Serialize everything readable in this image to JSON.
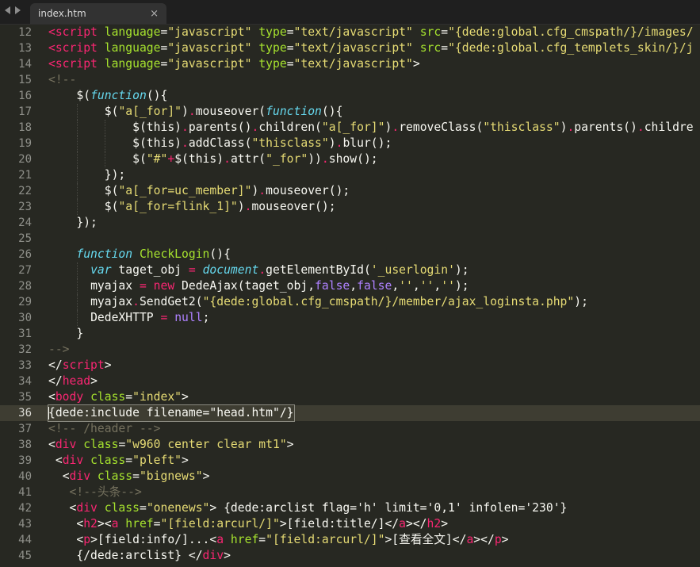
{
  "tab": {
    "title": "index.htm",
    "close_glyph": "×"
  },
  "editor": {
    "current_line": 36,
    "theme_colors": {
      "background": "#272822",
      "tag": "#f92672",
      "attribute": "#a6e22e",
      "string": "#e6db74",
      "comment": "#75715e",
      "keyword": "#66d9ef"
    },
    "lines": [
      {
        "n": 12,
        "indent": 0,
        "tokens": [
          [
            "t",
            "<script "
          ],
          [
            "a",
            "language"
          ],
          [
            "w",
            "="
          ],
          [
            "s",
            "\"javascript\" "
          ],
          [
            "a",
            "type"
          ],
          [
            "w",
            "="
          ],
          [
            "s",
            "\"text/javascript\" "
          ],
          [
            "a",
            "src"
          ],
          [
            "w",
            "="
          ],
          [
            "s",
            "\"{dede:global.cfg_cmspath/}/images/"
          ]
        ]
      },
      {
        "n": 13,
        "indent": 0,
        "tokens": [
          [
            "t",
            "<script "
          ],
          [
            "a",
            "language"
          ],
          [
            "w",
            "="
          ],
          [
            "s",
            "\"javascript\" "
          ],
          [
            "a",
            "type"
          ],
          [
            "w",
            "="
          ],
          [
            "s",
            "\"text/javascript\" "
          ],
          [
            "a",
            "src"
          ],
          [
            "w",
            "="
          ],
          [
            "s",
            "\"{dede:global.cfg_templets_skin/}/j"
          ]
        ]
      },
      {
        "n": 14,
        "indent": 0,
        "tokens": [
          [
            "t",
            "<script "
          ],
          [
            "a",
            "language"
          ],
          [
            "w",
            "="
          ],
          [
            "s",
            "\"javascript\" "
          ],
          [
            "a",
            "type"
          ],
          [
            "w",
            "="
          ],
          [
            "s",
            "\"text/javascript\""
          ],
          [
            "w",
            ">"
          ]
        ]
      },
      {
        "n": 15,
        "indent": 0,
        "tokens": [
          [
            "c",
            "<!--"
          ]
        ]
      },
      {
        "n": 16,
        "indent": 4,
        "tokens": [
          [
            "w",
            "$("
          ],
          [
            "k",
            "function"
          ],
          [
            "w",
            "(){"
          ]
        ]
      },
      {
        "n": 17,
        "indent": 8,
        "tokens": [
          [
            "w",
            "$("
          ],
          [
            "s",
            "\"a[_for]\""
          ],
          [
            "w",
            ")"
          ],
          [
            "o",
            "."
          ],
          [
            "w",
            "mouseover("
          ],
          [
            "k",
            "function"
          ],
          [
            "w",
            "(){"
          ]
        ]
      },
      {
        "n": 18,
        "indent": 12,
        "tokens": [
          [
            "w",
            "$(this)"
          ],
          [
            "o",
            "."
          ],
          [
            "w",
            "parents()"
          ],
          [
            "o",
            "."
          ],
          [
            "w",
            "children("
          ],
          [
            "s",
            "\"a[_for]\""
          ],
          [
            "w",
            ")"
          ],
          [
            "o",
            "."
          ],
          [
            "w",
            "removeClass("
          ],
          [
            "s",
            "\"thisclass\""
          ],
          [
            "w",
            ")"
          ],
          [
            "o",
            "."
          ],
          [
            "w",
            "parents()"
          ],
          [
            "o",
            "."
          ],
          [
            "w",
            "childre"
          ]
        ]
      },
      {
        "n": 19,
        "indent": 12,
        "tokens": [
          [
            "w",
            "$(this)"
          ],
          [
            "o",
            "."
          ],
          [
            "w",
            "addClass("
          ],
          [
            "s",
            "\"thisclass\""
          ],
          [
            "w",
            ")"
          ],
          [
            "o",
            "."
          ],
          [
            "w",
            "blur();"
          ]
        ]
      },
      {
        "n": 20,
        "indent": 12,
        "tokens": [
          [
            "w",
            "$("
          ],
          [
            "s",
            "\"#\""
          ],
          [
            "o",
            "+"
          ],
          [
            "w",
            "$(this)"
          ],
          [
            "o",
            "."
          ],
          [
            "w",
            "attr("
          ],
          [
            "s",
            "\"_for\""
          ],
          [
            "w",
            "))"
          ],
          [
            "o",
            "."
          ],
          [
            "w",
            "show();"
          ]
        ]
      },
      {
        "n": 21,
        "indent": 8,
        "tokens": [
          [
            "w",
            "});"
          ]
        ]
      },
      {
        "n": 22,
        "indent": 8,
        "tokens": [
          [
            "w",
            "$("
          ],
          [
            "s",
            "\"a[_for=uc_member]\""
          ],
          [
            "w",
            ")"
          ],
          [
            "o",
            "."
          ],
          [
            "w",
            "mouseover();"
          ]
        ]
      },
      {
        "n": 23,
        "indent": 8,
        "tokens": [
          [
            "w",
            "$("
          ],
          [
            "s",
            "\"a[_for=flink_1]\""
          ],
          [
            "w",
            ")"
          ],
          [
            "o",
            "."
          ],
          [
            "w",
            "mouseover();"
          ]
        ]
      },
      {
        "n": 24,
        "indent": 4,
        "tokens": [
          [
            "w",
            "});"
          ]
        ]
      },
      {
        "n": 25,
        "indent": 0,
        "tokens": []
      },
      {
        "n": 26,
        "indent": 4,
        "tokens": [
          [
            "k",
            "function"
          ],
          [
            "w",
            " "
          ],
          [
            "f",
            "CheckLogin"
          ],
          [
            "w",
            "(){"
          ]
        ]
      },
      {
        "n": 27,
        "indent": 6,
        "tokens": [
          [
            "k",
            "var"
          ],
          [
            "w",
            " taget_obj "
          ],
          [
            "o",
            "="
          ],
          [
            "w",
            " "
          ],
          [
            "k",
            "document"
          ],
          [
            "o",
            "."
          ],
          [
            "w",
            "getElementById("
          ],
          [
            "s",
            "'_userlogin'"
          ],
          [
            "w",
            ");"
          ]
        ]
      },
      {
        "n": 28,
        "indent": 6,
        "tokens": [
          [
            "w",
            "myajax "
          ],
          [
            "o",
            "="
          ],
          [
            "w",
            " "
          ],
          [
            "o",
            "new"
          ],
          [
            "w",
            " DedeAjax(taget_obj,"
          ],
          [
            "n",
            "false"
          ],
          [
            "w",
            ","
          ],
          [
            "n",
            "false"
          ],
          [
            "w",
            ","
          ],
          [
            "s",
            "''"
          ],
          [
            "w",
            ","
          ],
          [
            "s",
            "''"
          ],
          [
            "w",
            ","
          ],
          [
            "s",
            "''"
          ],
          [
            "w",
            ");"
          ]
        ]
      },
      {
        "n": 29,
        "indent": 6,
        "tokens": [
          [
            "w",
            "myajax"
          ],
          [
            "o",
            "."
          ],
          [
            "w",
            "SendGet2("
          ],
          [
            "s",
            "\"{dede:global.cfg_cmspath/}/member/ajax_loginsta.php\""
          ],
          [
            "w",
            ");"
          ]
        ]
      },
      {
        "n": 30,
        "indent": 6,
        "tokens": [
          [
            "w",
            "DedeXHTTP "
          ],
          [
            "o",
            "="
          ],
          [
            "w",
            " "
          ],
          [
            "n",
            "null"
          ],
          [
            "w",
            ";"
          ]
        ]
      },
      {
        "n": 31,
        "indent": 4,
        "tokens": [
          [
            "w",
            "}"
          ]
        ]
      },
      {
        "n": 32,
        "indent": 0,
        "tokens": [
          [
            "c",
            "-->"
          ]
        ]
      },
      {
        "n": 33,
        "indent": 0,
        "tokens": [
          [
            "w",
            "</"
          ],
          [
            "t",
            "script"
          ],
          [
            "w",
            ">"
          ]
        ]
      },
      {
        "n": 34,
        "indent": 0,
        "tokens": [
          [
            "w",
            "</"
          ],
          [
            "t",
            "head"
          ],
          [
            "w",
            ">"
          ]
        ]
      },
      {
        "n": 35,
        "indent": 0,
        "tokens": [
          [
            "w",
            "<"
          ],
          [
            "t",
            "body "
          ],
          [
            "a",
            "class"
          ],
          [
            "w",
            "="
          ],
          [
            "s",
            "\"index\""
          ],
          [
            "w",
            ">"
          ]
        ]
      },
      {
        "n": 36,
        "indent": 0,
        "tokens": [
          [
            "w",
            "{dede:include "
          ],
          [
            "w",
            "filename"
          ],
          [
            "w",
            "="
          ],
          [
            "w",
            "\"head.htm\""
          ],
          [
            "w",
            "/}"
          ]
        ]
      },
      {
        "n": 37,
        "indent": 0,
        "tokens": [
          [
            "c",
            "<!-- /header -->"
          ]
        ]
      },
      {
        "n": 38,
        "indent": 0,
        "tokens": [
          [
            "w",
            "<"
          ],
          [
            "t",
            "div "
          ],
          [
            "a",
            "class"
          ],
          [
            "w",
            "="
          ],
          [
            "s",
            "\"w960 center clear mt1\""
          ],
          [
            "w",
            ">"
          ]
        ]
      },
      {
        "n": 39,
        "indent": 1,
        "tokens": [
          [
            "w",
            "<"
          ],
          [
            "t",
            "div "
          ],
          [
            "a",
            "class"
          ],
          [
            "w",
            "="
          ],
          [
            "s",
            "\"pleft\""
          ],
          [
            "w",
            ">"
          ]
        ]
      },
      {
        "n": 40,
        "indent": 2,
        "tokens": [
          [
            "w",
            "<"
          ],
          [
            "t",
            "div "
          ],
          [
            "a",
            "class"
          ],
          [
            "w",
            "="
          ],
          [
            "s",
            "\"bignews\""
          ],
          [
            "w",
            ">"
          ]
        ]
      },
      {
        "n": 41,
        "indent": 3,
        "tokens": [
          [
            "c",
            "<!--头条-->"
          ]
        ]
      },
      {
        "n": 42,
        "indent": 3,
        "tokens": [
          [
            "w",
            "<"
          ],
          [
            "t",
            "div "
          ],
          [
            "a",
            "class"
          ],
          [
            "w",
            "="
          ],
          [
            "s",
            "\"onenews\""
          ],
          [
            "w",
            "> {dede:arclist flag='h' limit='0,1' infolen='230'}"
          ]
        ]
      },
      {
        "n": 43,
        "indent": 4,
        "tokens": [
          [
            "w",
            "<"
          ],
          [
            "t",
            "h2"
          ],
          [
            "w",
            "><"
          ],
          [
            "t",
            "a "
          ],
          [
            "a",
            "href"
          ],
          [
            "w",
            "="
          ],
          [
            "s",
            "\"[field:arcurl/]\""
          ],
          [
            "w",
            ">[field:title/]</"
          ],
          [
            "t",
            "a"
          ],
          [
            "w",
            "></"
          ],
          [
            "t",
            "h2"
          ],
          [
            "w",
            ">"
          ]
        ]
      },
      {
        "n": 44,
        "indent": 4,
        "tokens": [
          [
            "w",
            "<"
          ],
          [
            "t",
            "p"
          ],
          [
            "w",
            ">[field:info/]...<"
          ],
          [
            "t",
            "a "
          ],
          [
            "a",
            "href"
          ],
          [
            "w",
            "="
          ],
          [
            "s",
            "\"[field:arcurl/]\""
          ],
          [
            "w",
            ">[查看全文]</"
          ],
          [
            "t",
            "a"
          ],
          [
            "w",
            "></"
          ],
          [
            "t",
            "p"
          ],
          [
            "w",
            ">"
          ]
        ]
      },
      {
        "n": 45,
        "indent": 4,
        "tokens": [
          [
            "w",
            "{/dede:arclist} </"
          ],
          [
            "t",
            "div"
          ],
          [
            "w",
            ">"
          ]
        ]
      }
    ]
  }
}
